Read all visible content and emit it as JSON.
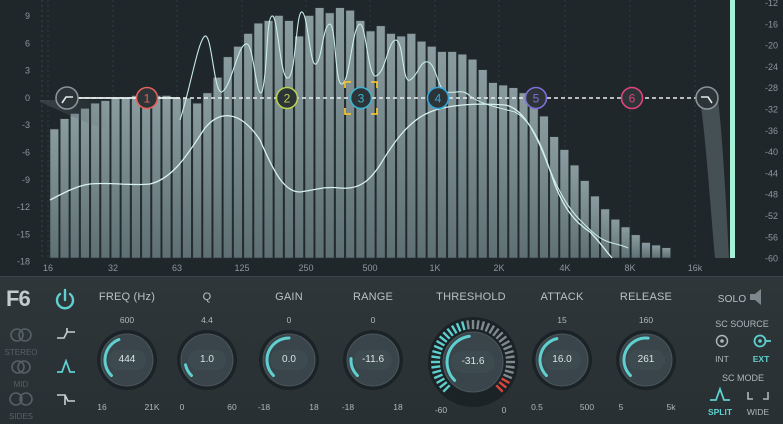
{
  "display": {
    "left_scale": [
      "9",
      "6",
      "3",
      "0",
      "-3",
      "-6",
      "-9",
      "-12",
      "-15",
      "-18"
    ],
    "right_scale": [
      "-12",
      "-16",
      "-20",
      "-24",
      "-28",
      "-32",
      "-36",
      "-40",
      "-44",
      "-48",
      "-52",
      "-56",
      "-60"
    ],
    "freq_scale": [
      "16",
      "32",
      "63",
      "125",
      "250",
      "500",
      "1K",
      "2K",
      "4K",
      "8K",
      "16k"
    ],
    "bands": [
      {
        "id": "1",
        "color": "#e5635a"
      },
      {
        "id": "2",
        "color": "#b7d24e"
      },
      {
        "id": "3",
        "color": "#3fb4cf"
      },
      {
        "id": "4",
        "color": "#35a7db"
      },
      {
        "id": "5",
        "color": "#7e6fd8"
      },
      {
        "id": "6",
        "color": "#e0447a"
      }
    ],
    "analyzer_levels": [
      0.5,
      0.54,
      0.56,
      0.58,
      0.6,
      0.61,
      0.62,
      0.62,
      0.63,
      0.63,
      0.63,
      0.63,
      0.62,
      0.62,
      0.6,
      0.64,
      0.7,
      0.78,
      0.82,
      0.87,
      0.91,
      0.92,
      0.94,
      0.92,
      0.86,
      0.94,
      0.97,
      0.95,
      0.97,
      0.96,
      0.92,
      0.88,
      0.9,
      0.87,
      0.86,
      0.87,
      0.84,
      0.82,
      0.8,
      0.8,
      0.79,
      0.77,
      0.73,
      0.68,
      0.67,
      0.66,
      0.64,
      0.61,
      0.55,
      0.47,
      0.42,
      0.36,
      0.3,
      0.24,
      0.19,
      0.15,
      0.12,
      0.09,
      0.06,
      0.05,
      0.04
    ]
  },
  "logo": "F6",
  "side_modes": [
    "STEREO",
    "MID",
    "SIDES"
  ],
  "knobs": [
    {
      "key": "freq",
      "label": "FREQ (Hz)",
      "top": "600",
      "min": "16",
      "max": "21K",
      "value": "444",
      "fill": 0.42
    },
    {
      "key": "q",
      "label": "Q",
      "top": "4.4",
      "min": "0",
      "max": "60",
      "value": "1.0",
      "fill": 0.12
    },
    {
      "key": "gain",
      "label": "GAIN",
      "top": "0",
      "min": "-18",
      "max": "18",
      "value": "0.0",
      "fill": 0.5
    },
    {
      "key": "range",
      "label": "RANGE",
      "top": "0",
      "min": "-18",
      "max": "18",
      "value": "-11.6",
      "fill": 0.18
    },
    {
      "key": "attack",
      "label": "ATTACK",
      "top": "15",
      "min": "0.5",
      "max": "500",
      "value": "16.0",
      "fill": 0.45
    },
    {
      "key": "release",
      "label": "RELEASE",
      "top": "160",
      "min": "5",
      "max": "5k",
      "value": "261",
      "fill": 0.52
    }
  ],
  "threshold": {
    "label": "THRESHOLD",
    "min": "-60",
    "max": "0",
    "value": "-31.6",
    "fill": 0.47
  },
  "solo_label": "SOLO",
  "sc_source": {
    "title": "SC SOURCE",
    "int": "INT",
    "ext": "EXT"
  },
  "sc_mode": {
    "title": "SC MODE",
    "split": "SPLIT",
    "wide": "WIDE"
  }
}
